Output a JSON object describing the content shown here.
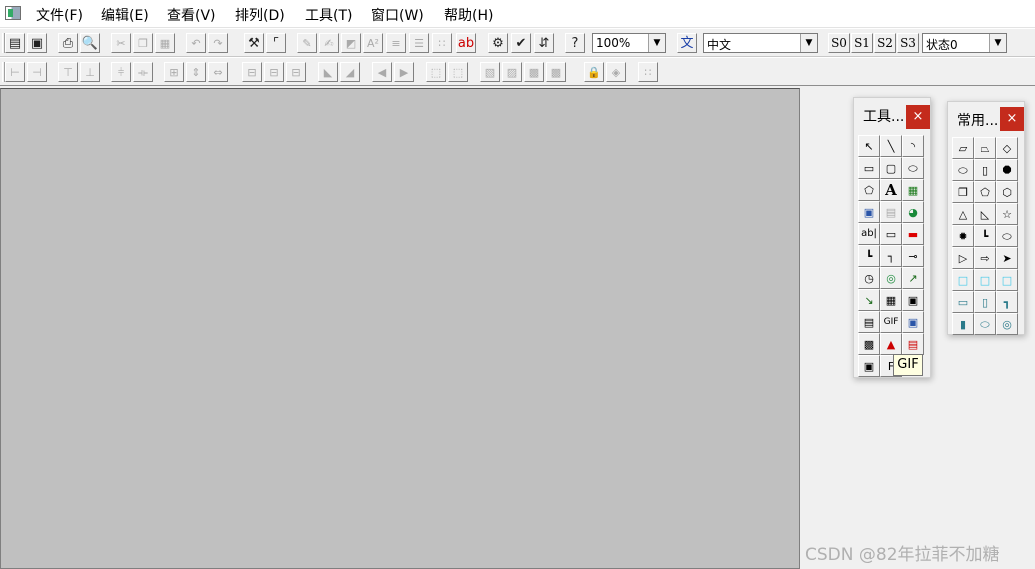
{
  "menu": {
    "items": [
      {
        "label": "文件(F)",
        "name": "menu-file"
      },
      {
        "label": "编辑(E)",
        "name": "menu-edit"
      },
      {
        "label": "查看(V)",
        "name": "menu-view"
      },
      {
        "label": "排列(D)",
        "name": "menu-arrange"
      },
      {
        "label": "工具(T)",
        "name": "menu-tools"
      },
      {
        "label": "窗口(W)",
        "name": "menu-window"
      },
      {
        "label": "帮助(H)",
        "name": "menu-help"
      }
    ]
  },
  "toolbar": {
    "zoom_value": "100%",
    "language_value": "中文",
    "state_buttons": [
      "S0",
      "S1",
      "S2",
      "S3"
    ],
    "state_value": "状态0"
  },
  "tools_palette": {
    "title": "工具...",
    "close_label": "×",
    "gif_label": "GIF",
    "partial_label": "F"
  },
  "common_palette": {
    "title": "常用...",
    "close_label": "×"
  },
  "tooltip": {
    "text": "GIF"
  },
  "watermark": {
    "text": "CSDN @82年拉菲不加糖"
  }
}
